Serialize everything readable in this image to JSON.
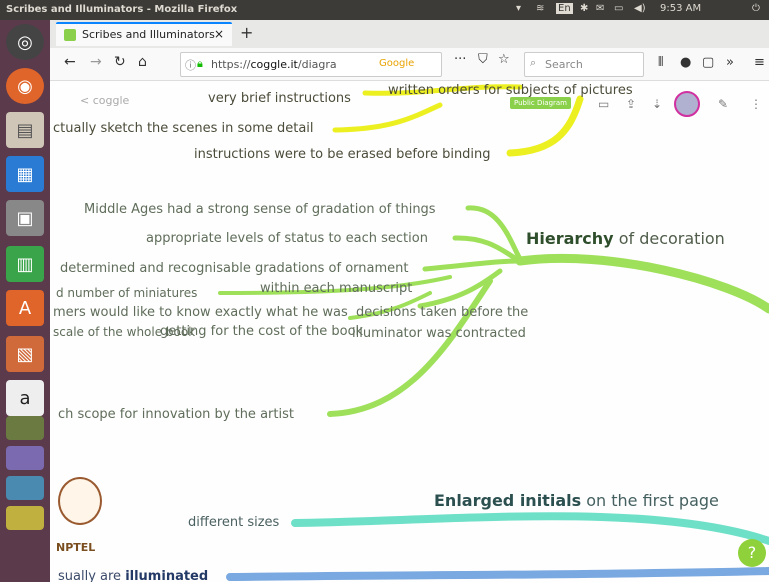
{
  "os_bar": {
    "window_title": "Scribes and Illuminators - Mozilla Firefox",
    "keyboard": "En",
    "time": "9:53 AM"
  },
  "launcher": {
    "items": [
      "ubuntu-dash",
      "firefox",
      "files",
      "writer",
      "impress",
      "calc",
      "software",
      "document-viewer",
      "amazon",
      "stack-1",
      "stack-2",
      "stack-3",
      "stack-4"
    ]
  },
  "browser": {
    "tab_title": "Scribes and Illuminators",
    "tab_close": "×",
    "new_tab": "+",
    "url_prefix": "https://",
    "url_domain": "coggle.it",
    "url_path": "/diagra",
    "url_badge": "Google",
    "search_placeholder": "Search",
    "page_actions": "···",
    "overflow": "»",
    "menu": "≡"
  },
  "coggle": {
    "back_link": "< coggle",
    "public_badge": "Public Diagram"
  },
  "nodes": {
    "n1": "very brief instructions",
    "n2": "written orders for subjects of pictures",
    "n3": "ctually sketch the scenes in some detail",
    "n4": "instructions were to be erased before binding",
    "n5": "Middle Ages had a strong sense of gradation of things",
    "n6": "appropriate levels of status to each section",
    "n7_bold": "Hierarchy",
    "n7_rest": " of decoration",
    "n8": "determined and recognisable gradations of ornament",
    "n9": "d number of miniatures",
    "n10": "within each manuscript",
    "n11": "mers would like to know exactly what he was",
    "n12": "decisions taken before the",
    "n13": "scale of the whole book",
    "n14": "getting for the cost of the book",
    "n15": "illuminator was contracted",
    "n16": "ch scope for innovation by the artist",
    "n17_bold": "Enlarged initials",
    "n17_rest": " on the first page",
    "n18": "different sizes",
    "n19_plain": "sually are ",
    "n19_bold": "illuminated"
  },
  "watermark": {
    "label": "NPTEL"
  },
  "help_button": "?",
  "colors": {
    "yellow_branch": "#ecf020",
    "green_branch": "#9fe05a",
    "teal_branch": "#6fe0c8",
    "blue_branch": "#7aa8e0",
    "launcher_bg": "#5b3a4b",
    "topbar_bg": "#3c3b37"
  }
}
